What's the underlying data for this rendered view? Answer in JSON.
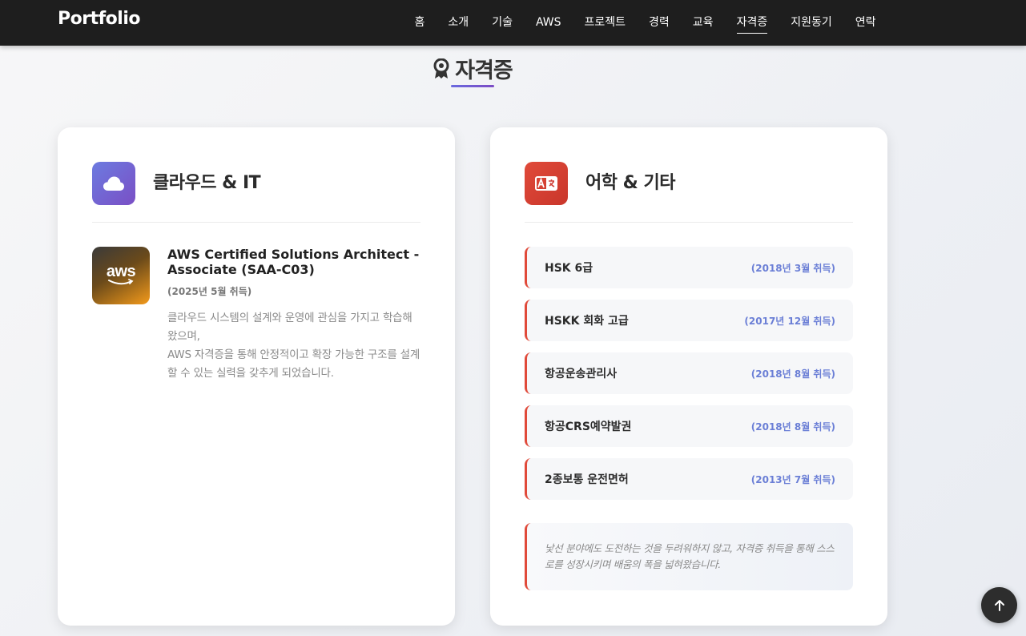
{
  "navbar": {
    "brand": "Portfolio",
    "items": [
      {
        "label": "홈"
      },
      {
        "label": "소개"
      },
      {
        "label": "기술"
      },
      {
        "label": "AWS"
      },
      {
        "label": "프로젝트"
      },
      {
        "label": "경력"
      },
      {
        "label": "교육"
      },
      {
        "label": "자격증",
        "active": true
      },
      {
        "label": "지원동기"
      },
      {
        "label": "연락"
      }
    ]
  },
  "section": {
    "title": "자격증",
    "icon": "award-icon"
  },
  "cloud_card": {
    "icon": "cloud-icon",
    "title": "클라우드 & IT",
    "cert": {
      "logo_text": "aws",
      "name": "AWS Certified Solutions Architect - Associate (SAA-C03)",
      "date": "(2025년 5월 취득)",
      "desc_line1": "클라우드 시스템의 설계와 운영에 관심을 가지고 학습해 왔으며,",
      "desc_line2": "AWS 자격증을 통해 안정적이고 확장 가능한 구조를 설계할 수 있는 실력을 갖추게 되었습니다."
    }
  },
  "lang_card": {
    "icon": "translate-icon",
    "title": "어학 & 기타",
    "items": [
      {
        "name": "HSK 6급",
        "date": "(2018년 3월 취득)"
      },
      {
        "name": "HSKK 회화 고급",
        "date": "(2017년 12월 취득)"
      },
      {
        "name": "항공운송관리사",
        "date": "(2018년 8월 취득)"
      },
      {
        "name": "항공CRS예약발권",
        "date": "(2018년 8월 취득)"
      },
      {
        "name": "2종보통 운전면허",
        "date": "(2013년 7월 취득)"
      }
    ],
    "note": "낯선 분야에도 도전하는 것을 두려워하지 않고, 자격증 취득을 통해 스스로를 성장시키며 배움의 폭을 넓혀왔습니다."
  },
  "colors": {
    "navbar_bg": "#1e1e1e",
    "accent_purple": "#7a4fc5",
    "accent_red": "#e04a3a",
    "date_blue": "#6b7fd6"
  },
  "scroll_top": {
    "icon": "arrow-up-icon"
  }
}
